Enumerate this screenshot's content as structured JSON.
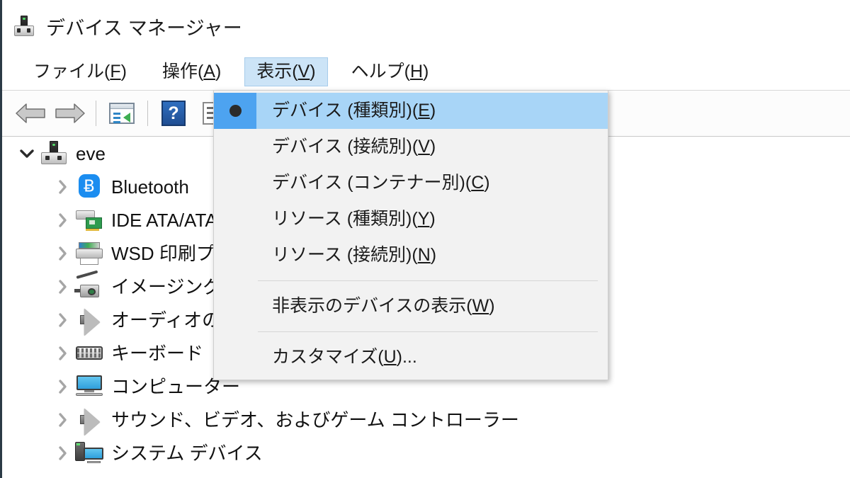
{
  "window": {
    "title": "デバイス マネージャー",
    "icon": "device-manager-icon"
  },
  "menubar": {
    "items": [
      {
        "label": "ファイル(F)",
        "text": "ファイル(",
        "accel": "F",
        "tail": ")",
        "open": false
      },
      {
        "label": "操作(A)",
        "text": "操作(",
        "accel": "A",
        "tail": ")",
        "open": false
      },
      {
        "label": "表示(V)",
        "text": "表示(",
        "accel": "V",
        "tail": ")",
        "open": true
      },
      {
        "label": "ヘルプ(H)",
        "text": "ヘルプ(",
        "accel": "H",
        "tail": ")",
        "open": false
      }
    ]
  },
  "toolbar": {
    "buttons": [
      {
        "name": "back-button",
        "icon": "arrow-left-icon"
      },
      {
        "name": "forward-button",
        "icon": "arrow-right-icon"
      },
      {
        "name": "properties-button",
        "icon": "properties-icon"
      },
      {
        "name": "help-button",
        "icon": "help-icon",
        "glyph": "?"
      },
      {
        "name": "scan-hardware-button",
        "icon": "scan-hardware-icon"
      }
    ]
  },
  "view_menu": {
    "items": [
      {
        "text": "デバイス (種類別)(",
        "accel": "E",
        "tail": ")",
        "selected": true,
        "bullet": true,
        "separator_after": false
      },
      {
        "text": "デバイス (接続別)(",
        "accel": "V",
        "tail": ")",
        "selected": false,
        "bullet": false,
        "separator_after": false
      },
      {
        "text": "デバイス (コンテナー別)(",
        "accel": "C",
        "tail": ")",
        "selected": false,
        "bullet": false,
        "separator_after": false
      },
      {
        "text": "リソース (種類別)(",
        "accel": "Y",
        "tail": ")",
        "selected": false,
        "bullet": false,
        "separator_after": false
      },
      {
        "text": "リソース (接続別)(",
        "accel": "N",
        "tail": ")",
        "selected": false,
        "bullet": false,
        "separator_after": true
      },
      {
        "text": "非表示のデバイスの表示(",
        "accel": "W",
        "tail": ")",
        "selected": false,
        "bullet": false,
        "separator_after": true
      },
      {
        "text": "カスタマイズ(",
        "accel": "U",
        "tail": ")...",
        "selected": false,
        "bullet": false,
        "separator_after": false
      }
    ]
  },
  "tree": {
    "nodes": [
      {
        "label": "eve",
        "depth": 0,
        "expanded": true,
        "icon": "device-manager-icon"
      },
      {
        "label": "Bluetooth",
        "depth": 1,
        "expanded": false,
        "icon": "bluetooth-icon"
      },
      {
        "label": "IDE ATA/ATAPI コントローラー",
        "depth": 1,
        "expanded": false,
        "icon": "ide-controller-icon"
      },
      {
        "label": "WSD 印刷プロバイダー",
        "depth": 1,
        "expanded": false,
        "icon": "printer-icon"
      },
      {
        "label": "イメージング デバイス",
        "depth": 1,
        "expanded": false,
        "icon": "imaging-device-icon"
      },
      {
        "label": "オーディオの入力および出力",
        "depth": 1,
        "expanded": false,
        "icon": "speaker-icon"
      },
      {
        "label": "キーボード",
        "depth": 1,
        "expanded": false,
        "icon": "keyboard-icon"
      },
      {
        "label": "コンピューター",
        "depth": 1,
        "expanded": false,
        "icon": "monitor-icon"
      },
      {
        "label": "サウンド、ビデオ、およびゲーム コントローラー",
        "depth": 1,
        "expanded": false,
        "icon": "speaker-icon"
      },
      {
        "label": "システム デバイス",
        "depth": 1,
        "expanded": false,
        "icon": "system-device-icon"
      }
    ]
  },
  "colors": {
    "menu_selection": "#a8d5f7",
    "menu_gutter_selection": "#4da3f0",
    "menubar_open": "#cce4f7",
    "menu_background": "#f2f2f2",
    "window_border": "#2b3a46"
  }
}
